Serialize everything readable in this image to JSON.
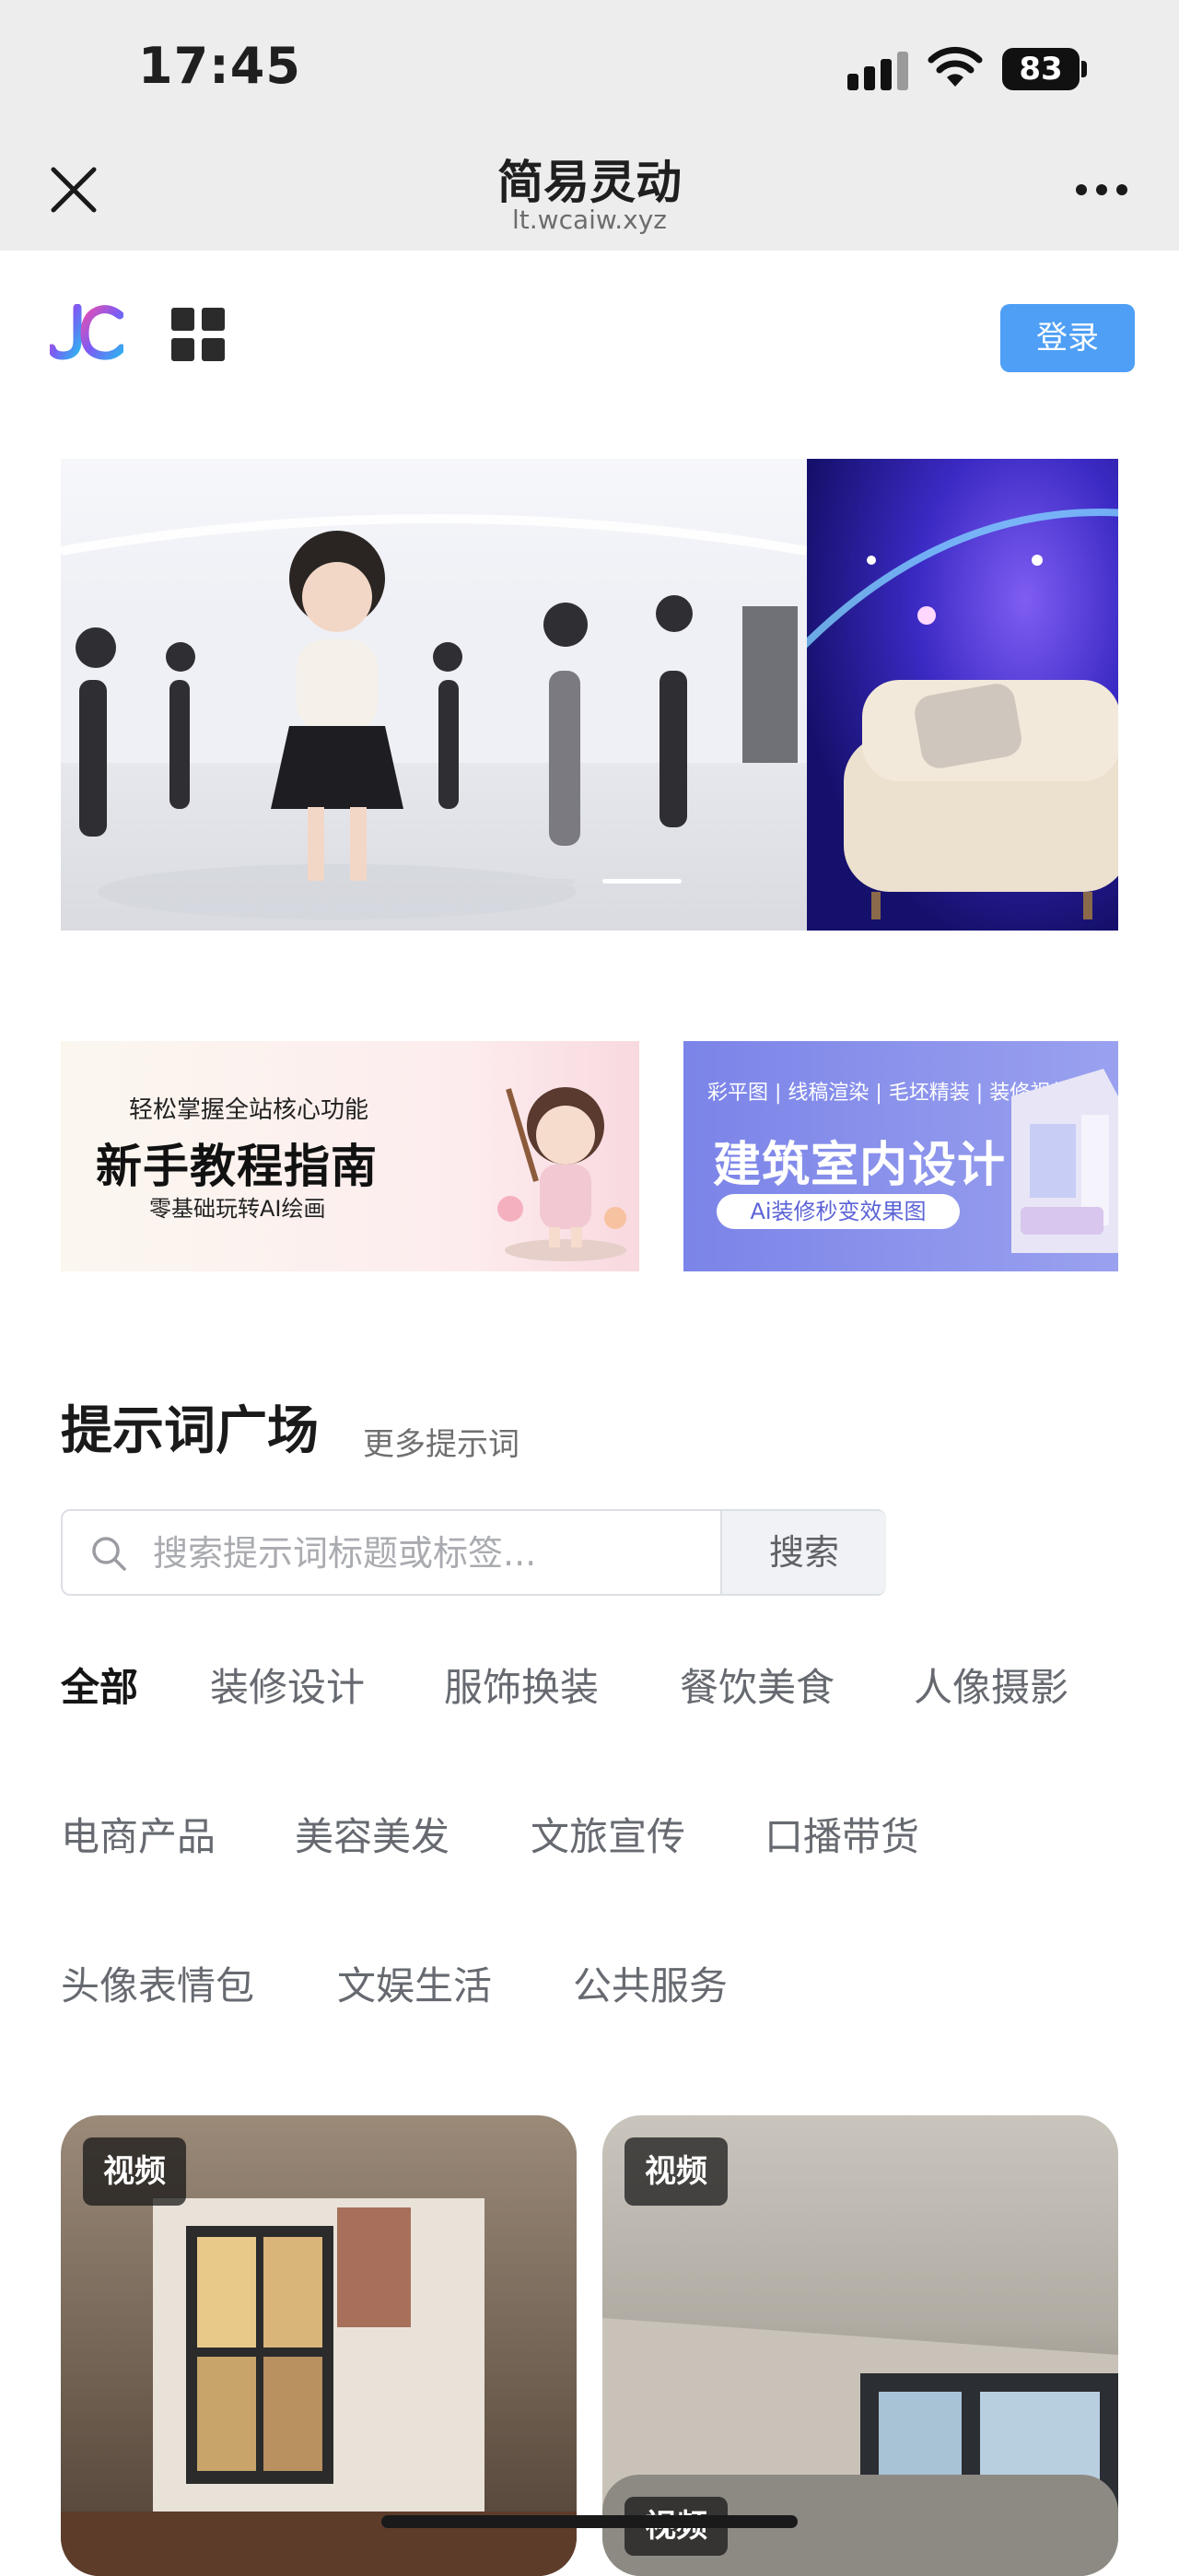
{
  "status_bar": {
    "time": "17:45",
    "battery": "83"
  },
  "nav": {
    "title": "简易灵动",
    "subtitle": "lt.wcaiw.xyz"
  },
  "site_header": {
    "login_label": "登录"
  },
  "promos": [
    {
      "kicker": "轻松掌握全站核心功能",
      "title": "新手教程指南",
      "subtitle": "零基础玩转AI绘画"
    },
    {
      "tags": "彩平图 | 线稿渲染 | 毛坯精装 | 装修视频",
      "title": "建筑室内设计",
      "pill": "Ai装修秒变效果图"
    }
  ],
  "prompt_plaza": {
    "title": "提示词广场",
    "more": "更多提示词",
    "search_placeholder": "搜索提示词标题或标签...",
    "search_button": "搜索",
    "tags": [
      "全部",
      "装修设计",
      "服饰换装",
      "餐饮美食",
      "人像摄影",
      "电商产品",
      "美容美发",
      "文旅宣传",
      "口播带货",
      "头像表情包",
      "文娱生活",
      "公共服务"
    ]
  },
  "cards": [
    {
      "badge": "视频"
    },
    {
      "badge": "视频"
    },
    {
      "badge": "视频"
    }
  ],
  "colors": {
    "accent": "#4e9ff5",
    "header_bg": "#ededed"
  }
}
